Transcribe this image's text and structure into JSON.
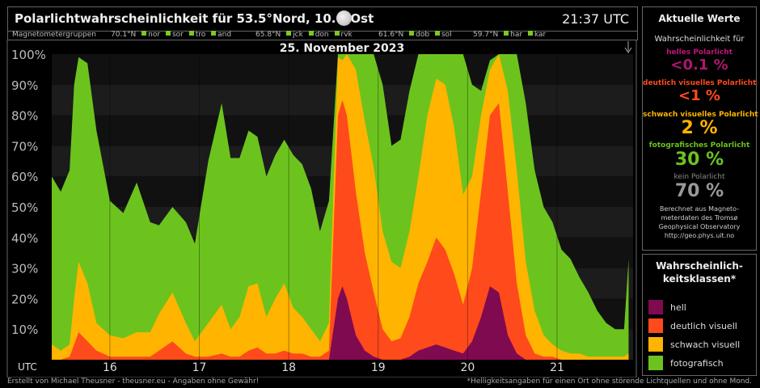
{
  "header": {
    "title": "Polarlichtwahrscheinlichkeit für  53.5°Nord, 10.0°Ost",
    "time": "21:37 UTC"
  },
  "magnetometer": {
    "label": "Magnetometergruppen",
    "groups": [
      {
        "lat": "70.1°N",
        "stations": [
          "nor",
          "sor",
          "tro",
          "and"
        ]
      },
      {
        "lat": "65.8°N",
        "stations": [
          "jck",
          "don",
          "rvk"
        ]
      },
      {
        "lat": "61.6°N",
        "stations": [
          "dob",
          "sol"
        ]
      },
      {
        "lat": "59.7°N",
        "stations": [
          "har",
          "kar"
        ]
      }
    ]
  },
  "current": {
    "title": "Aktuelle Werte",
    "intro": "Wahrscheinlichkeit für",
    "rows": [
      {
        "label": "helles Polarlicht",
        "value": "<0.1 %",
        "color": "#8a0a5a"
      },
      {
        "label": "deutlich visuelles Polarlicht",
        "value": "<1 %",
        "color": "#ff4a1c"
      },
      {
        "label": "schwach visuelles Polarlicht",
        "value": "2 %",
        "color": "#ffb400"
      },
      {
        "label": "fotografisches Polarlicht",
        "value": "30 %",
        "color": "#6cc31e"
      },
      {
        "label": "kein Polarlicht",
        "value": "70 %",
        "color": "#9a9a9a"
      }
    ],
    "note": [
      "Berechnet aus Magneto-",
      "meterdaten des Tromsø",
      "Geophysical Observatory",
      "http://geo.phys.uit.no"
    ]
  },
  "classes": {
    "title_line1": "Wahrscheinlich-",
    "title_line2": "keitsklassen*",
    "items": [
      {
        "label": "hell",
        "color": "#800a50"
      },
      {
        "label": "deutlich visuell",
        "color": "#ff4a1c"
      },
      {
        "label": "schwach visuell",
        "color": "#ffb400"
      },
      {
        "label": "fotografisch",
        "color": "#6cc31e"
      }
    ]
  },
  "footer": {
    "left": "Erstellt von Michael Theusner - theusner.eu - Angaben ohne Gewähr!",
    "right": "*Helligkeitsangaben für einen Ort ohne störende Lichtquellen und ohne Mond."
  },
  "chart_data": {
    "type": "area",
    "title": "25. November 2023",
    "xlabel": "UTC",
    "ylabel": "",
    "y_ticks": [
      "10%",
      "20%",
      "30%",
      "40%",
      "50%",
      "60%",
      "70%",
      "80%",
      "90%",
      "100%"
    ],
    "x_tick_labels": [
      "16",
      "17",
      "18",
      "19",
      "20",
      "21"
    ],
    "x_tick_hours": [
      16,
      17,
      18,
      19,
      20,
      21
    ],
    "xlim": [
      15.35,
      21.85
    ],
    "ylim": [
      0,
      100
    ],
    "grid": true,
    "stacking": "cumulative",
    "x": [
      15.35,
      15.45,
      15.55,
      15.6,
      15.65,
      15.75,
      15.85,
      16.0,
      16.15,
      16.3,
      16.45,
      16.55,
      16.7,
      16.85,
      16.95,
      17.1,
      17.25,
      17.35,
      17.45,
      17.55,
      17.65,
      17.75,
      17.85,
      17.95,
      18.05,
      18.15,
      18.25,
      18.35,
      18.45,
      18.55,
      18.6,
      18.65,
      18.75,
      18.85,
      18.95,
      19.05,
      19.15,
      19.25,
      19.35,
      19.45,
      19.55,
      19.65,
      19.75,
      19.85,
      19.95,
      20.05,
      20.15,
      20.25,
      20.35,
      20.45,
      20.55,
      20.65,
      20.75,
      20.85,
      20.95,
      21.05,
      21.15,
      21.25,
      21.35,
      21.45,
      21.55,
      21.65,
      21.75,
      21.8
    ],
    "series": [
      {
        "name": "fotografisch",
        "values": [
          60,
          55,
          62,
          90,
          99,
          97,
          75,
          52,
          48,
          58,
          45,
          44,
          50,
          45,
          38,
          65,
          84,
          66,
          66,
          75,
          73,
          60,
          67,
          72,
          67,
          64,
          56,
          42,
          52,
          100,
          100,
          100,
          100,
          100,
          100,
          90,
          70,
          72,
          88,
          100,
          100,
          100,
          100,
          100,
          100,
          90,
          88,
          98,
          100,
          100,
          100,
          84,
          62,
          50,
          45,
          36,
          33,
          27,
          22,
          16,
          12,
          10,
          10,
          33
        ]
      },
      {
        "name": "schwach visuell",
        "values": [
          5,
          3,
          5,
          20,
          32,
          25,
          12,
          8,
          7,
          9,
          9,
          15,
          22,
          12,
          6,
          12,
          18,
          10,
          14,
          24,
          25,
          14,
          20,
          25,
          17,
          14,
          10,
          6,
          12,
          99,
          98,
          100,
          95,
          78,
          63,
          42,
          32,
          30,
          42,
          60,
          80,
          92,
          90,
          76,
          54,
          60,
          80,
          95,
          100,
          88,
          62,
          32,
          16,
          8,
          5,
          3,
          2,
          2,
          1,
          1,
          1,
          1,
          1,
          2
        ]
      },
      {
        "name": "deutlich visuell",
        "values": [
          0,
          0,
          1,
          5,
          9,
          6,
          3,
          1,
          1,
          1,
          1,
          3,
          6,
          2,
          1,
          1,
          2,
          1,
          1,
          3,
          4,
          2,
          2,
          3,
          2,
          2,
          1,
          1,
          3,
          80,
          85,
          80,
          55,
          35,
          22,
          10,
          6,
          7,
          14,
          25,
          32,
          40,
          36,
          28,
          18,
          30,
          55,
          80,
          84,
          55,
          25,
          8,
          2,
          1,
          1,
          0,
          0,
          0,
          0,
          0,
          0,
          0,
          0,
          0
        ]
      },
      {
        "name": "hell",
        "values": [
          0,
          0,
          0,
          0,
          0,
          0,
          0,
          0,
          0,
          0,
          0,
          0,
          0,
          0,
          0,
          0,
          0,
          0,
          0,
          0,
          0,
          0,
          0,
          0,
          0,
          0,
          0,
          0,
          0,
          20,
          24,
          20,
          8,
          3,
          1,
          0,
          0,
          0,
          1,
          3,
          4,
          5,
          4,
          3,
          2,
          6,
          14,
          24,
          22,
          8,
          2,
          0,
          0,
          0,
          0,
          0,
          0,
          0,
          0,
          0,
          0,
          0,
          0,
          0
        ]
      }
    ]
  }
}
